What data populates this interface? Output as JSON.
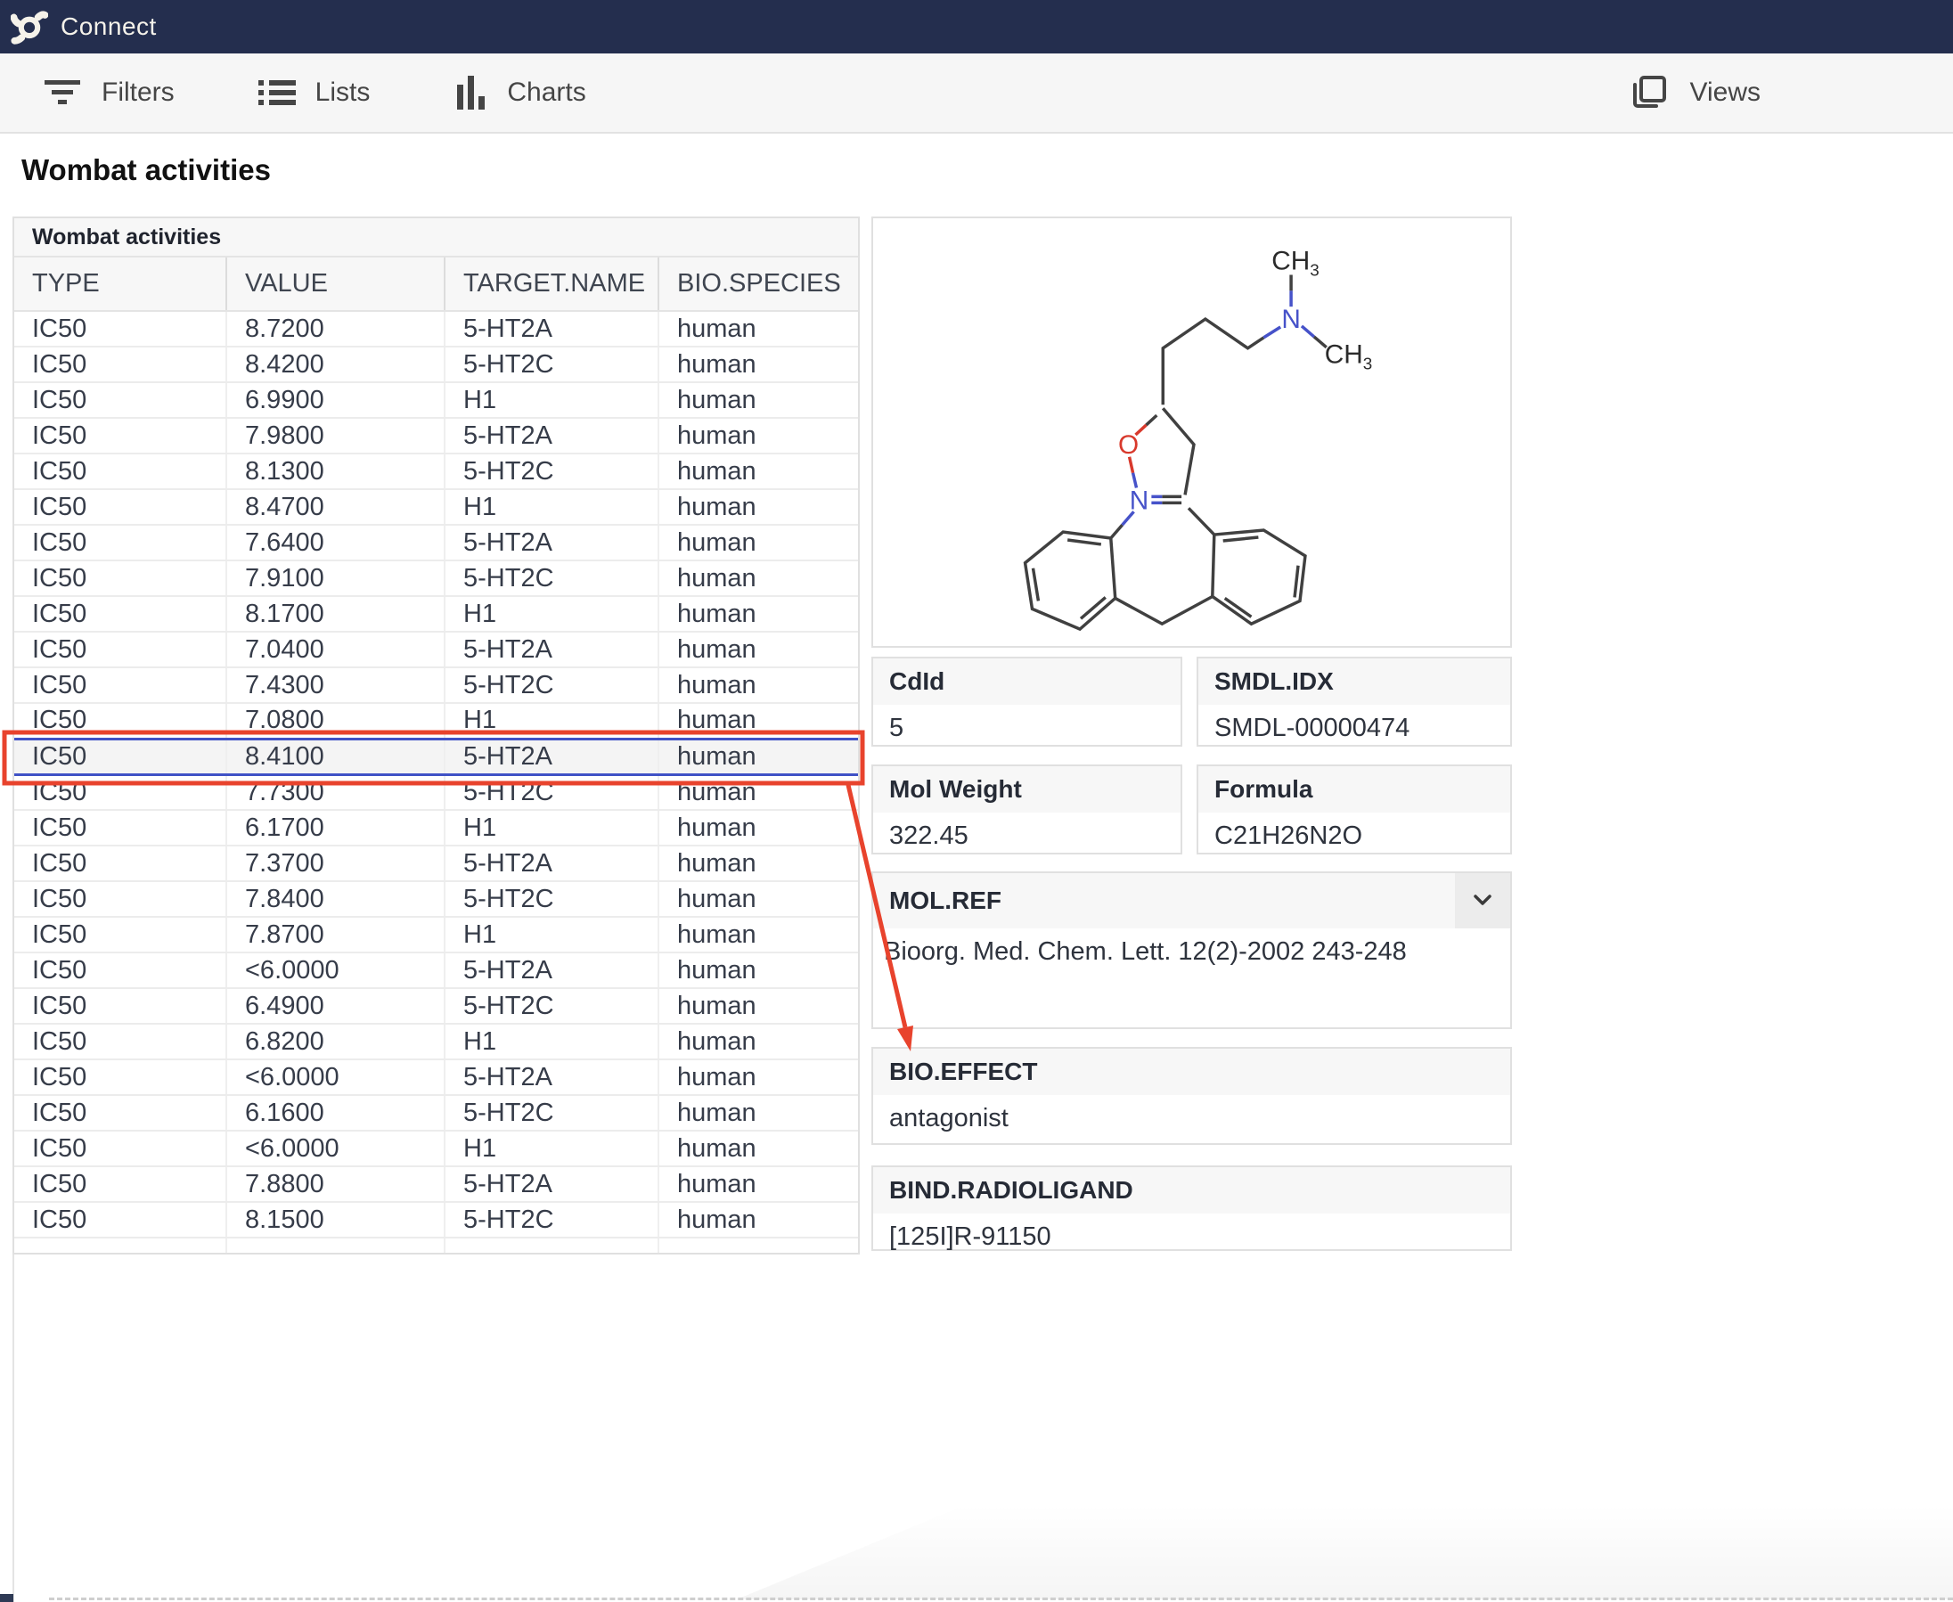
{
  "app": {
    "brand": "Connect"
  },
  "toolbar": {
    "filters": "Filters",
    "lists": "Lists",
    "charts": "Charts",
    "views": "Views"
  },
  "page": {
    "title": "Wombat activities"
  },
  "table": {
    "panel_title": "Wombat activities",
    "columns": [
      "TYPE",
      "VALUE",
      "TARGET.NAME",
      "BIO.SPECIES"
    ],
    "selected_index": 12,
    "rows": [
      [
        "IC50",
        "8.7200",
        "5-HT2A",
        "human"
      ],
      [
        "IC50",
        "8.4200",
        "5-HT2C",
        "human"
      ],
      [
        "IC50",
        "6.9900",
        "H1",
        "human"
      ],
      [
        "IC50",
        "7.9800",
        "5-HT2A",
        "human"
      ],
      [
        "IC50",
        "8.1300",
        "5-HT2C",
        "human"
      ],
      [
        "IC50",
        "8.4700",
        "H1",
        "human"
      ],
      [
        "IC50",
        "7.6400",
        "5-HT2A",
        "human"
      ],
      [
        "IC50",
        "7.9100",
        "5-HT2C",
        "human"
      ],
      [
        "IC50",
        "8.1700",
        "H1",
        "human"
      ],
      [
        "IC50",
        "7.0400",
        "5-HT2A",
        "human"
      ],
      [
        "IC50",
        "7.4300",
        "5-HT2C",
        "human"
      ],
      [
        "IC50",
        "7.0800",
        "H1",
        "human"
      ],
      [
        "IC50",
        "8.4100",
        "5-HT2A",
        "human"
      ],
      [
        "IC50",
        "7.7300",
        "5-HT2C",
        "human"
      ],
      [
        "IC50",
        "6.1700",
        "H1",
        "human"
      ],
      [
        "IC50",
        "7.3700",
        "5-HT2A",
        "human"
      ],
      [
        "IC50",
        "7.8400",
        "5-HT2C",
        "human"
      ],
      [
        "IC50",
        "7.8700",
        "H1",
        "human"
      ],
      [
        "IC50",
        "<6.0000",
        "5-HT2A",
        "human"
      ],
      [
        "IC50",
        "6.4900",
        "5-HT2C",
        "human"
      ],
      [
        "IC50",
        "6.8200",
        "H1",
        "human"
      ],
      [
        "IC50",
        "<6.0000",
        "5-HT2A",
        "human"
      ],
      [
        "IC50",
        "6.1600",
        "5-HT2C",
        "human"
      ],
      [
        "IC50",
        "<6.0000",
        "H1",
        "human"
      ],
      [
        "IC50",
        "7.8800",
        "5-HT2A",
        "human"
      ],
      [
        "IC50",
        "8.1500",
        "5-HT2C",
        "human"
      ]
    ]
  },
  "details": {
    "fields": [
      {
        "label": "CdId",
        "value": "5"
      },
      {
        "label": "SMDL.IDX",
        "value": "SMDL-00000474"
      },
      {
        "label": "Mol Weight",
        "value": "322.45"
      },
      {
        "label": "Formula",
        "value": "C21H26N2O"
      },
      {
        "label": "MOL.REF",
        "value": "Bioorg. Med. Chem. Lett. 12(2)-2002 243-248"
      },
      {
        "label": "BIO.EFFECT",
        "value": "antagonist"
      },
      {
        "label": "BIND.RADIOLIGAND",
        "value": "[125I]R-91150"
      }
    ]
  },
  "molecule": {
    "o": "O",
    "n": "N",
    "ch": "CH",
    "sub": "3"
  },
  "colors": {
    "navy": "#242e4e",
    "red": "#e8432d",
    "blue": "#4052c6",
    "atomo": "#d8392c",
    "atomn": "#4652c9",
    "bond": "#404040"
  }
}
